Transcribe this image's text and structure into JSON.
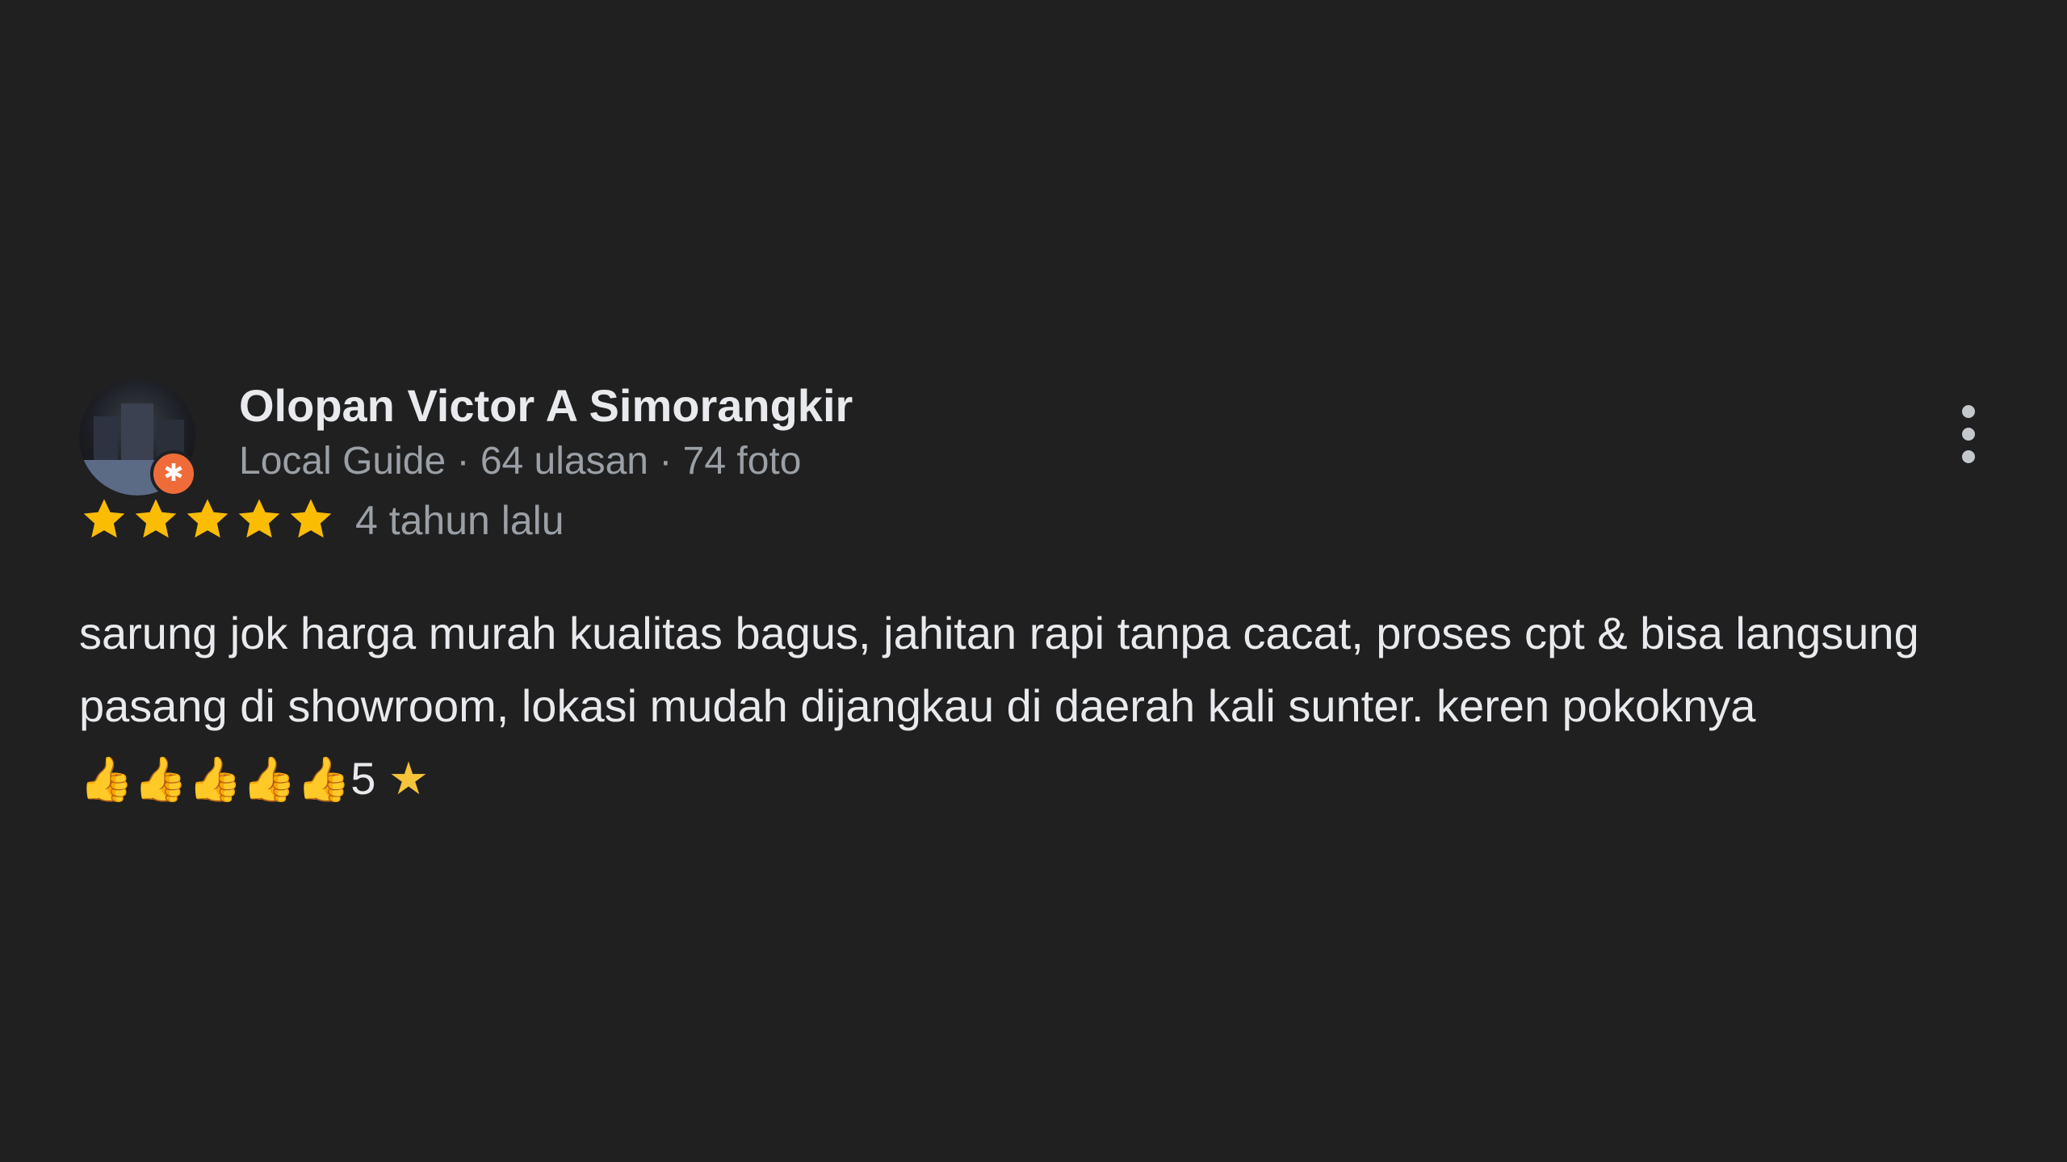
{
  "reviewer": {
    "name": "Olopan Victor A Simorangkir",
    "meta": "Local Guide · 64 ulasan · 74 foto",
    "badge_icon": "local-guide-badge-icon"
  },
  "rating": {
    "stars": 5,
    "max": 5,
    "star_color": "#fbbc04",
    "time_ago": "4 tahun lalu"
  },
  "review": {
    "text": "sarung jok harga murah kualitas bagus, jahitan rapi tanpa cacat, proses cpt & bisa langsung pasang di showroom, lokasi mudah dijangkau di daerah kali sunter. keren pokoknya",
    "emojis": "👍👍👍👍👍",
    "suffix_number": "5",
    "suffix_star": "★"
  },
  "colors": {
    "background": "#202020",
    "primary_text": "#e8eaed",
    "secondary_text": "#9aa0a6",
    "badge": "#ef6c3a"
  }
}
